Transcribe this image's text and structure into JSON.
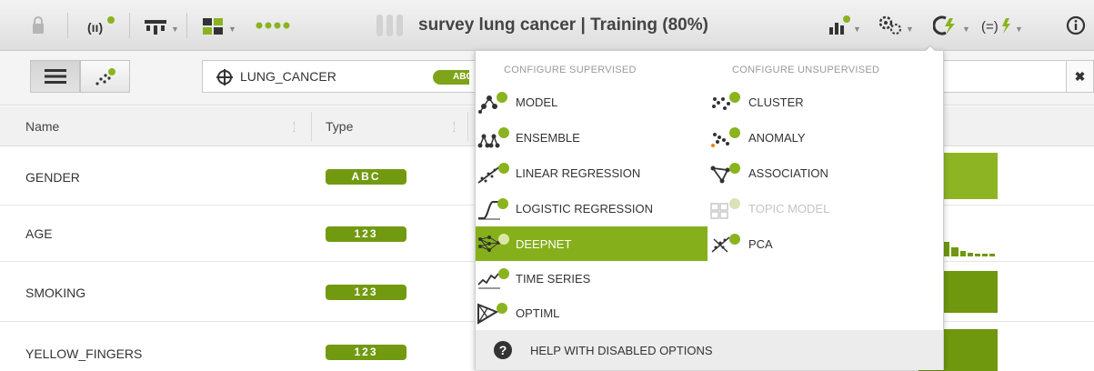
{
  "toolbar": {
    "title": "survey lung cancer | Training (80%)",
    "icons": [
      "lock-icon",
      "sources-icon",
      "datasets-icon",
      "models-icon",
      "dots-icon",
      "chart-icon",
      "settings-icon",
      "actions-icon",
      "formula-icon",
      "info-icon"
    ]
  },
  "subbar": {
    "objective_field": "LUNG_CANCER",
    "objective_badge": "ABC",
    "clear_label": "✖"
  },
  "table": {
    "headers": {
      "name": "Name",
      "type": "Type"
    },
    "rows": [
      {
        "name": "GENDER",
        "type": "ABC"
      },
      {
        "name": "AGE",
        "type": "123"
      },
      {
        "name": "SMOKING",
        "type": "123"
      },
      {
        "name": "YELLOW_FINGERS",
        "type": "123"
      }
    ]
  },
  "menu": {
    "supervised_heading": "CONFIGURE SUPERVISED",
    "unsupervised_heading": "CONFIGURE UNSUPERVISED",
    "supervised_items": [
      {
        "label": "MODEL",
        "icon": "model-icon"
      },
      {
        "label": "ENSEMBLE",
        "icon": "ensemble-icon"
      },
      {
        "label": "LINEAR REGRESSION",
        "icon": "linear-regression-icon"
      },
      {
        "label": "LOGISTIC REGRESSION",
        "icon": "logistic-regression-icon"
      },
      {
        "label": "DEEPNET",
        "icon": "deepnet-icon",
        "selected": true
      },
      {
        "label": "TIME SERIES",
        "icon": "time-series-icon"
      },
      {
        "label": "OPTIML",
        "icon": "optiml-icon"
      }
    ],
    "unsupervised_items": [
      {
        "label": "CLUSTER",
        "icon": "cluster-icon"
      },
      {
        "label": "ANOMALY",
        "icon": "anomaly-icon"
      },
      {
        "label": "ASSOCIATION",
        "icon": "association-icon"
      },
      {
        "label": "TOPIC MODEL",
        "icon": "topic-model-icon",
        "disabled": true
      },
      {
        "label": "PCA",
        "icon": "pca-icon"
      }
    ],
    "help_label": "HELP WITH DISABLED OPTIONS",
    "help_glyph": "?"
  },
  "colors": {
    "accent_green": "#86b01b",
    "badge_green": "#729a11",
    "bar_light": "#8db523",
    "bar_dark": "#6f980e"
  }
}
